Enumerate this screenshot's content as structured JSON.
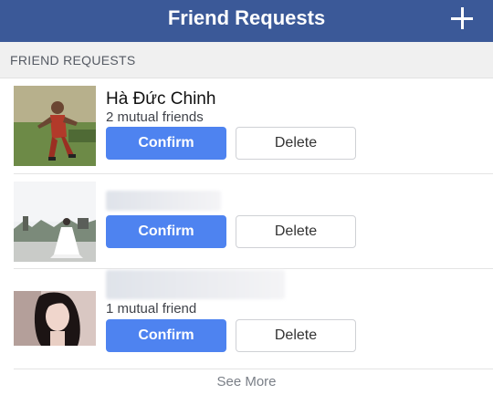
{
  "navbar": {
    "title": "Friend Requests",
    "add_icon": "plus-icon"
  },
  "section": {
    "header": "FRIEND REQUESTS"
  },
  "requests": [
    {
      "name": "Hà Đức Chinh",
      "mutual": "2 mutual friends",
      "confirm_label": "Confirm",
      "delete_label": "Delete"
    },
    {
      "name": "",
      "mutual": "",
      "confirm_label": "Confirm",
      "delete_label": "Delete"
    },
    {
      "name": "",
      "mutual": "1 mutual friend",
      "confirm_label": "Confirm",
      "delete_label": "Delete"
    }
  ],
  "footer": {
    "see_more": "See More"
  },
  "colors": {
    "navbar": "#3b5998",
    "confirm": "#4e83f0"
  }
}
